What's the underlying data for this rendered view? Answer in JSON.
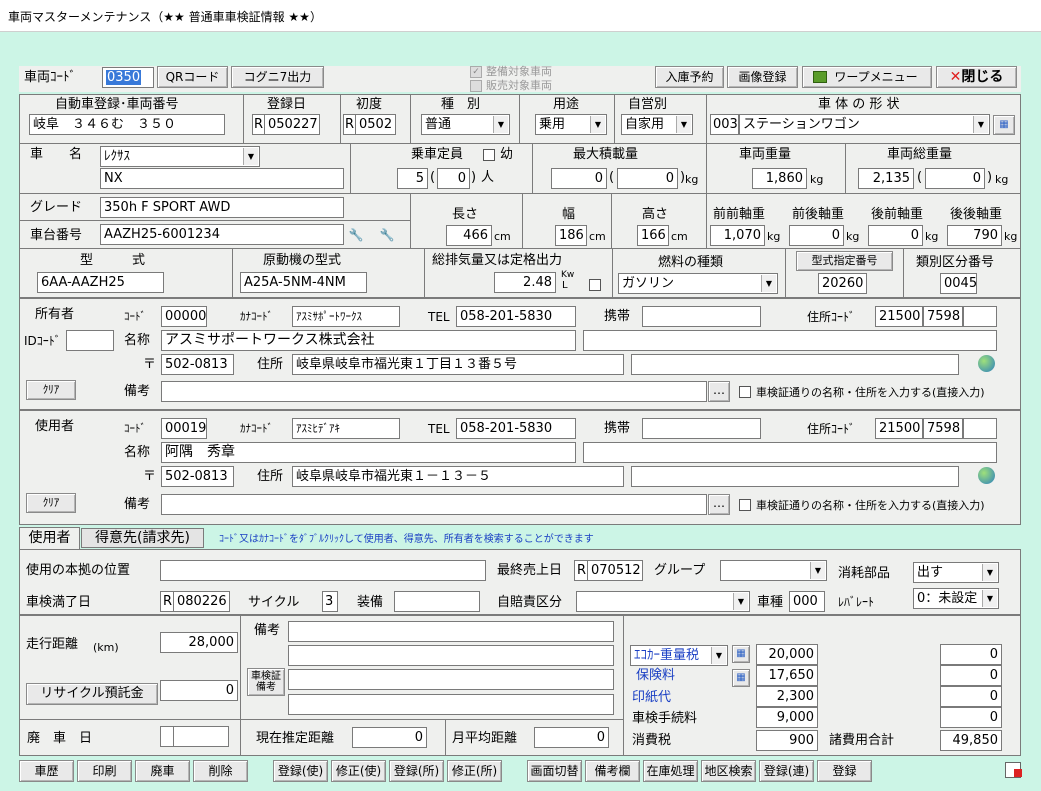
{
  "window": {
    "title": "車両マスターメンテナンス（★★ 普通車車検証情報 ★★）"
  },
  "colors": {
    "accent_blue": "#1a3fc4",
    "select_highlight": "#3879d9",
    "background": "#ccf5e6",
    "close_red": "#e02020"
  },
  "toolbar": {
    "vehicle_code_label": "車両ｺｰﾄﾞ",
    "vehicle_code": "0350",
    "qr_code": "QRコード",
    "kogunina_out": "コグニ7出力",
    "maintenance_target": "整備対象車両",
    "sales_target": "販売対象車両",
    "entry_reservation": "入庫予約",
    "image_register": "画像登録",
    "word_menu": "ワープメニュー",
    "close": "閉じる"
  },
  "header": {
    "reg_number_label": "自動車登録･車両番号",
    "reg_number": "岐阜　３４６む　３５０",
    "reg_date_label": "登録日",
    "reg_date_prefix": "R",
    "reg_date": "050227",
    "first_reg_label": "初度",
    "first_reg_prefix": "R",
    "first_reg": "0502",
    "kind_label": "種　別",
    "kind": "普通",
    "use_label": "用途",
    "use": "乗用",
    "private_label": "自営別",
    "private": "自家用",
    "body_shape_label": "車 体 の 形 状",
    "body_shape_code": "003",
    "body_shape": "ステーションワゴン"
  },
  "vehicle": {
    "name_label": "車　　名",
    "maker": "ﾚｸｻｽ",
    "model": "NX",
    "capacity_label": "乗車定員",
    "child_label": "幼",
    "capacity": "5",
    "capacity_child": "0",
    "person_unit": "人",
    "max_load_label": "最大積載量",
    "max_load": "0",
    "max_load2": "0",
    "kg": "kg",
    "weight_label": "車両重量",
    "weight": "1,860",
    "gross_label": "車両総重量",
    "gross": "2,135",
    "gross2": "0",
    "grade_label": "グレード",
    "grade": "350h F SPORT AWD",
    "chassis_label": "車台番号",
    "chassis": "AAZH25-6001234",
    "length_label": "長さ",
    "length": "466",
    "width_label": "幅",
    "width": "186",
    "height_label": "高さ",
    "height": "166",
    "cm": "cm",
    "ff_axle_label": "前前軸重",
    "ff_axle": "1,070",
    "fr_axle_label": "前後軸重",
    "fr_axle": "0",
    "rf_axle_label": "後前軸重",
    "rf_axle": "0",
    "rr_axle_label": "後後軸重",
    "rr_axle": "790",
    "model_type_label": "型　　　式",
    "model_type": "6AA-AAZH25",
    "engine_label": "原動機の型式",
    "engine": "A25A-5NM-4NM",
    "displacement_label": "総排気量又は定格出力",
    "displacement": "2.48",
    "kw": "Kw",
    "l": "L",
    "fuel_label": "燃料の種類",
    "fuel": "ガソリン",
    "type_designation_btn": "型式指定番号",
    "type_designation": "20260",
    "class_label": "類別区分番号",
    "class_number": "0045"
  },
  "owner": {
    "section": "所有者",
    "code_label": "ｺｰﾄﾞ",
    "code": "00000",
    "kana_label": "ｶﾅｺｰﾄﾞ",
    "kana": "ｱｽﾐｻﾎﾟｰﾄﾜｰｸｽ",
    "tel_label": "TEL",
    "tel": "058-201-5830",
    "mobile_label": "携帯",
    "mobile": "",
    "addr_code_label": "住所ｺｰﾄﾞ",
    "addr_code1": "21500",
    "addr_code2": "7598",
    "id_label": "IDｺｰﾄﾞ",
    "name_label": "名称",
    "name": "アスミサポートワークス株式会社",
    "zip_label": "〒",
    "zip": "502-0813",
    "addr_label": "住所",
    "addr": "岐阜県岐阜市福光東１丁目１３番５号",
    "clear": "ｸﾘｱ",
    "memo_label": "備考",
    "direct_input": "車検証通りの名称・住所を入力する(直接入力)"
  },
  "user": {
    "section": "使用者",
    "code_label": "ｺｰﾄﾞ",
    "code": "00019",
    "kana_label": "ｶﾅｺｰﾄﾞ",
    "kana": "ｱｽﾐﾋﾃﾞｱｷ",
    "tel_label": "TEL",
    "tel": "058-201-5830",
    "mobile_label": "携帯",
    "mobile": "",
    "addr_code_label": "住所ｺｰﾄﾞ",
    "addr_code1": "21500",
    "addr_code2": "7598",
    "name_label": "名称",
    "name": "阿隅　秀章",
    "zip_label": "〒",
    "zip": "502-0813",
    "addr_label": "住所",
    "addr": "岐阜県岐阜市福光東１－１３－５",
    "clear": "ｸﾘｱ",
    "memo_label": "備考",
    "direct_input": "車検証通りの名称・住所を入力する(直接入力)"
  },
  "tabs": [
    {
      "label": "使用者"
    },
    {
      "label": "得意先(請求先)"
    }
  ],
  "tab_hint": "ｺｰﾄﾞ又はｶﾅｺｰﾄﾞをﾀﾞﾌﾞﾙｸﾘｯｸして使用者、得意先、所有者を検索することができます",
  "usage": {
    "location_label": "使用の本拠の位置",
    "last_sale_label": "最終売上日",
    "last_sale_prefix": "R",
    "last_sale": "070512",
    "group_label": "グループ",
    "consumable_label": "消耗部品",
    "consumable": "出す",
    "inspection_label": "車検満了日",
    "inspection_prefix": "R",
    "inspection": "080226",
    "cycle_label": "サイクル",
    "cycle": "3",
    "equipment_label": "装備",
    "insurance_label": "自賠責区分",
    "car_type_label": "車種",
    "car_type": "000",
    "rate_label": "ﾚﾊﾞﾚｰﾄ",
    "rate": "0：未設定"
  },
  "mileage": {
    "distance_label": "走行距離",
    "distance_unit": "(km)",
    "distance": "28,000",
    "recycle_label": "リサイクル預託金",
    "recycle": "0",
    "scrap_label": "廃　車　日",
    "memo_label": "備考",
    "cert_memo_label1": "車検証",
    "cert_memo_label2": "備考",
    "est_label": "現在推定距離",
    "est": "0",
    "monthly_label": "月平均距離",
    "monthly": "0"
  },
  "fees": {
    "eco_weight": "ｴｺｶｰ重量税",
    "insurance": "保険料",
    "stamp": "印紙代",
    "service": "車検手続料",
    "tax": "消費税",
    "total_label": "諸費用合計",
    "v1": "20,000",
    "v2": "17,650",
    "v3": "2,300",
    "v4": "9,000",
    "v5": "900",
    "r1": "0",
    "r2": "0",
    "r3": "0",
    "r4": "0",
    "total": "49,850"
  },
  "footer": {
    "history": "車歴",
    "print": "印刷",
    "scrap": "廃車",
    "delete": "削除",
    "reg_user": "登録(使)",
    "mod_user": "修正(使)",
    "reg_owner": "登録(所)",
    "mod_owner": "修正(所)",
    "screen_switch": "画面切替",
    "memo_col": "備考欄",
    "stock": "在庫処理",
    "area_search": "地区検索",
    "reg_cont": "登録(連)",
    "register": "登録"
  }
}
